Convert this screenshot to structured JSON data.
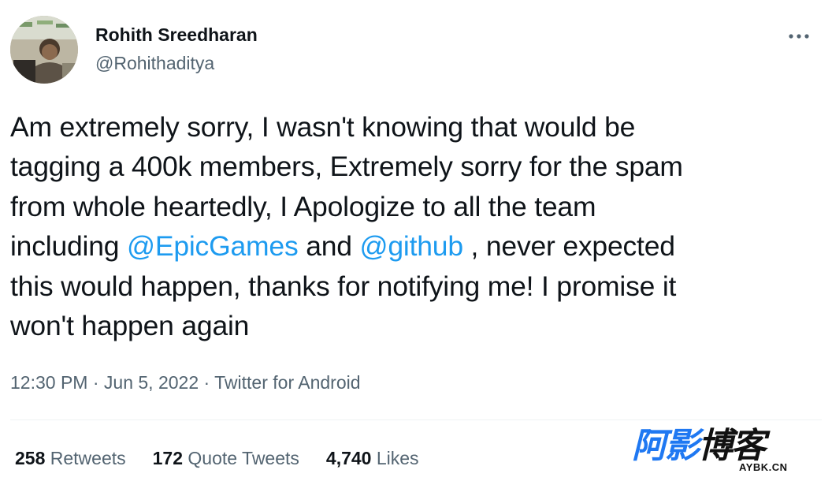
{
  "author": {
    "display_name": "Rohith Sreedharan",
    "handle": "@Rohithaditya",
    "avatar_icon": "profile-photo"
  },
  "menu_icon": "more-horizontal-icon",
  "tweet": {
    "lines": [
      [
        {
          "text": "Am extremely sorry, I wasn't knowing that would be"
        }
      ],
      [
        {
          "text": "tagging a 400k members, Extremely sorry for the spam"
        }
      ],
      [
        {
          "text": "from whole heartedly, I Apologize to all the team"
        }
      ],
      [
        {
          "text": "including "
        },
        {
          "text": "@EpicGames",
          "mention": true
        },
        {
          "text": " and "
        },
        {
          "text": "@github",
          "mention": true
        },
        {
          "text": " , never expected"
        }
      ],
      [
        {
          "text": "this would happen, thanks for notifying me! I promise it"
        }
      ],
      [
        {
          "text": "won't happen again"
        }
      ]
    ]
  },
  "meta": {
    "time": "12:30 PM",
    "separator": " · ",
    "date": "Jun 5, 2022",
    "source": "Twitter for Android"
  },
  "stats": [
    {
      "count": "258",
      "label": "Retweets"
    },
    {
      "count": "172",
      "label": "Quote Tweets"
    },
    {
      "count": "4,740",
      "label": "Likes"
    }
  ],
  "watermark": {
    "main": [
      "阿",
      "影",
      "博",
      "客"
    ],
    "sub": "AYBK.CN"
  },
  "colors": {
    "text": "#0f1419",
    "secondary": "#536471",
    "link": "#1d9bf0",
    "watermark_blue": "#1f78f2"
  }
}
